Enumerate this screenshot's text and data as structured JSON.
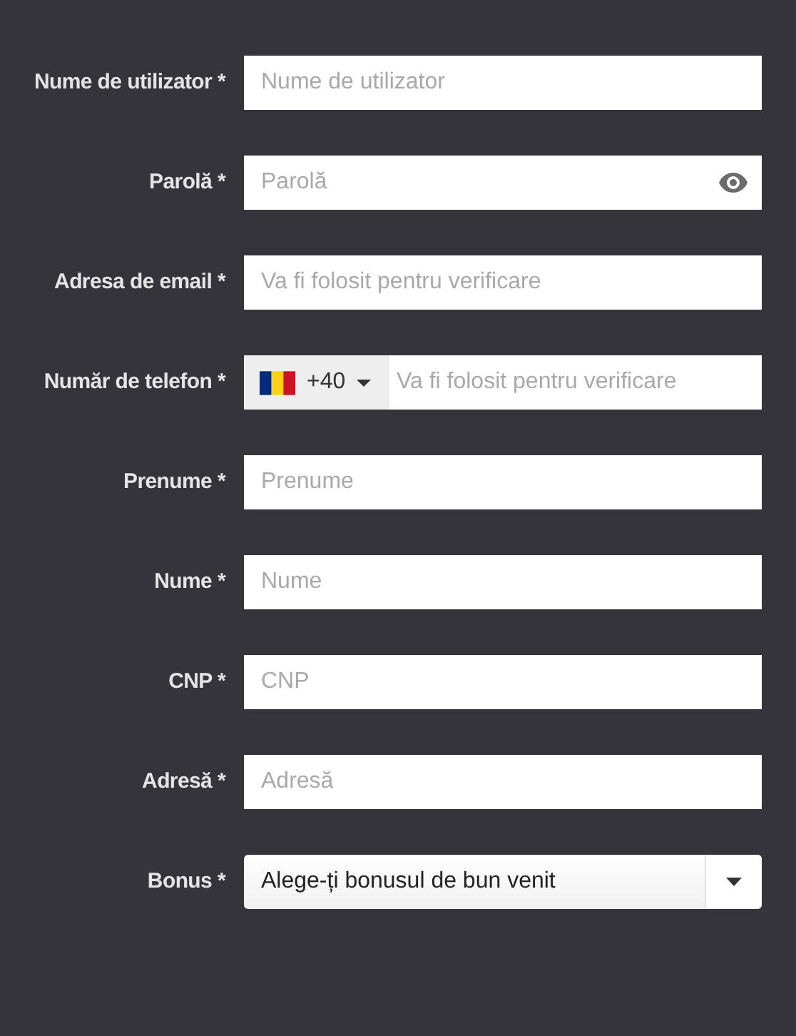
{
  "fields": [
    {
      "kind": "text",
      "label": "Nume de utilizator *",
      "placeholder": "Nume de utilizator"
    },
    {
      "kind": "password",
      "label": "Parolă *",
      "placeholder": "Parolă"
    },
    {
      "kind": "text",
      "label": "Adresa de email *",
      "placeholder": "Va fi folosit pentru verificare"
    },
    {
      "kind": "phone",
      "label": "Număr de telefon *",
      "country_code": "+40",
      "placeholder": "Va fi folosit pentru verificare"
    },
    {
      "kind": "text",
      "label": "Prenume *",
      "placeholder": "Prenume"
    },
    {
      "kind": "text",
      "label": "Nume *",
      "placeholder": "Nume"
    },
    {
      "kind": "text",
      "label": "CNP *",
      "placeholder": "CNP"
    },
    {
      "kind": "text",
      "label": "Adresă *",
      "placeholder": "Adresă"
    },
    {
      "kind": "select",
      "label": "Bonus *",
      "value": "Alege-ți bonusul de bun venit"
    }
  ]
}
